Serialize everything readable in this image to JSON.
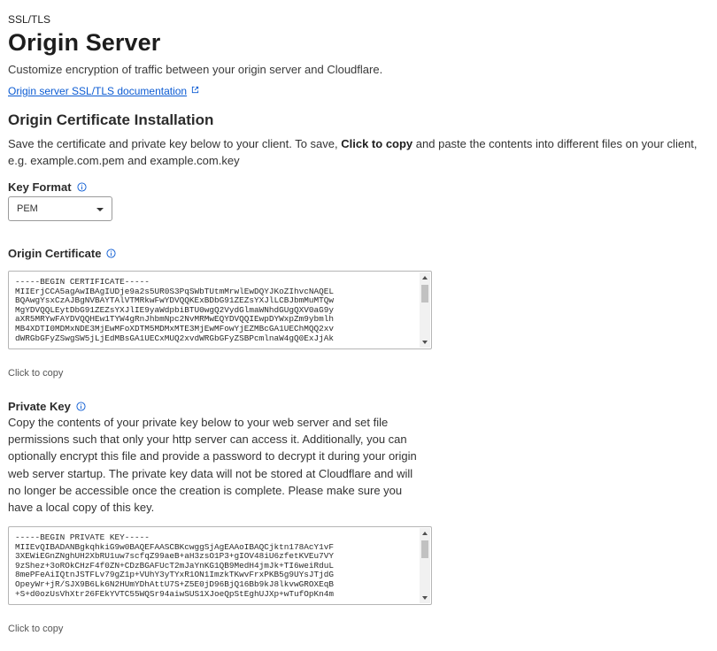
{
  "breadcrumb": "SSL/TLS",
  "title": "Origin Server",
  "subtitle": "Customize encryption of traffic between your origin server and Cloudflare.",
  "doc_link": "Origin server SSL/TLS documentation",
  "installation": {
    "heading": "Origin Certificate Installation",
    "desc_before": "Save the certificate and private key below to your client. To save, ",
    "desc_bold": "Click to copy",
    "desc_after": " and paste the contents into different files on your client, e.g. example.com.pem and example.com.key"
  },
  "key_format": {
    "label": "Key Format",
    "selected": "PEM"
  },
  "origin_certificate": {
    "label": "Origin Certificate",
    "content": "-----BEGIN CERTIFICATE-----\nMIIErjCCA5agAwIBAgIUDje9a2s5UR0S3PqSWbTUtmMrwlEwDQYJKoZIhvcNAQEL\nBQAwgYsxCzAJBgNVBAYTAlVTMRkwFwYDVQQKExBDbG91ZEZsYXJlLCBJbmMuMTQw\nMgYDVQQLEytDbG91ZEZsYXJlIE9yaWdpbiBTU0wgQ2VydGlmaWNhdGUgQXV0aG9y\naXR5MRYwFAYDVQQHEw1TYW4gRnJhbmNpc2NvMRMwEQYDVQQIEwpDYWxpZm9ybmlh\nMB4XDTI0MDMxNDE3MjEwMFoXDTM5MDMxMTE3MjEwMFowYjEZMBcGA1UEChMQQ2xv\ndWRGbGFyZSwgSW5jLjEdMBsGA1UECxMUQ2xvdWRGbGFyZSBPcmlnaW4gQ0ExJjAk",
    "copy_label": "Click to copy"
  },
  "private_key": {
    "label": "Private Key",
    "desc": "Copy the contents of your private key below to your web server and set file permissions such that only your http server can access it. Additionally, you can optionally encrypt this file and provide a password to decrypt it during your origin web server startup. The private key data will not be stored at Cloudflare and will no longer be accessible once the creation is complete. Please make sure you have a local copy of this key.",
    "content": "-----BEGIN PRIVATE KEY-----\nMIIEvQIBADANBgkqhkiG9w0BAQEFAASCBKcwggSjAgEAAoIBAQCjktn178AcY1vF\n3XEWiEGnZNghUH2XbRU1uw7scfqZ99aeB+aH3zsO1P3+gIOV48iU6zfetKVEu7VY\n9zShez+3oROkCHzF4f0ZN+CDzBGAFUcT2mJaYnKG1QB9MedH4jmJk+TI6weiRduL\n8mePFeAiIQtnJSTFLv79gZ1p+VUhY3yTYxR1ON1ImzkTKwvFrxPKB5g9UYsJTjdG\nOpeyWr+jR/SJX9B6Lk6N2HUmYDhAttU7S+Z5E0jD96BjQ16Bb9kJ8lkvwGROXEqB\n+S+d0ozUsVhXtr26FEkYVTC55WQSr94aiwSUS1XJoeQpStEghUJXp+wTufOpKn4m",
    "copy_label": "Click to copy"
  },
  "colors": {
    "link": "#0b5bd3",
    "text": "#313131"
  }
}
